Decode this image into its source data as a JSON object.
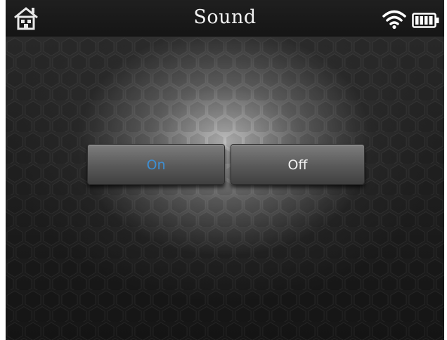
{
  "header": {
    "title": "Sound",
    "home_icon": "home-icon",
    "wifi_icon": "wifi-icon",
    "battery_icon": "battery-icon"
  },
  "sound_options": {
    "on_label": "On",
    "off_label": "Off",
    "selected": "On"
  },
  "colors": {
    "selected_text": "#3d8fd4",
    "unselected_text": "#f0f0f0",
    "topbar_bg": "#1a1a1a"
  }
}
